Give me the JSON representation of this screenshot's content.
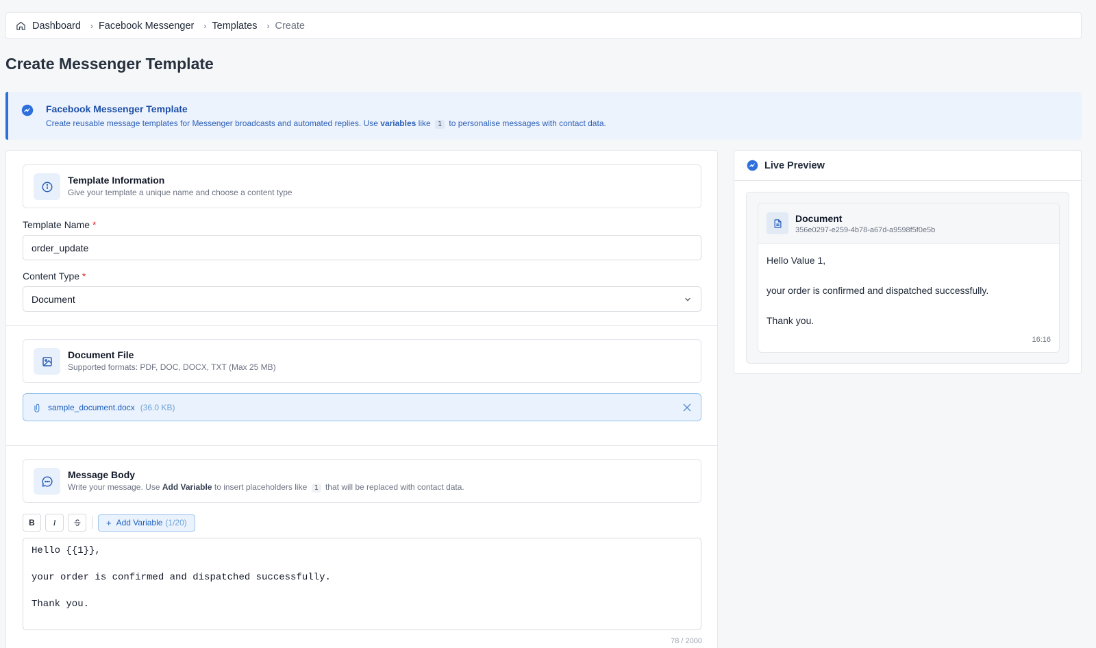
{
  "breadcrumb": {
    "home_icon": "home-icon",
    "items": [
      "Dashboard",
      "Facebook Messenger",
      "Templates",
      "Create"
    ]
  },
  "page": {
    "title": "Create Messenger Template"
  },
  "banner": {
    "icon": "messenger-icon",
    "title": "Facebook Messenger Template",
    "text_before": "Create reusable message templates for Messenger broadcasts and automated replies. Use ",
    "bold": "variables",
    "text_mid": " like ",
    "pill": "1",
    "text_after": " to personalise messages with contact data."
  },
  "template_info": {
    "icon": "info-icon",
    "title": "Template Information",
    "subtitle": "Give your template a unique name and choose a content type",
    "name_label": "Template Name",
    "name_value": "order_update",
    "type_label": "Content Type",
    "type_value": "Document",
    "required_mark": "*"
  },
  "document_file": {
    "icon": "image-icon",
    "title": "Document File",
    "subtitle": "Supported formats: PDF, DOC, DOCX, TXT (Max 25 MB)",
    "file_name": "sample_document.docx",
    "file_size": "(36.0 KB)"
  },
  "message_body": {
    "icon": "chat-icon",
    "title": "Message Body",
    "sub_before": "Write your message. Use ",
    "sub_bold": "Add Variable",
    "sub_mid": " to insert placeholders like ",
    "sub_pill": "1",
    "sub_after": " that will be replaced with contact data.",
    "toolbar": {
      "bold": "B",
      "italic": "I",
      "add_variable": "Add Variable",
      "variable_count": "(1/20)"
    },
    "content": "Hello {{1}},\n\nyour order is confirmed and dispatched successfully.\n\nThank you.",
    "char_count": "78 / 2000"
  },
  "preview": {
    "title": "Live Preview",
    "doc_title": "Document",
    "doc_id": "356e0297-e259-4b78-a67d-a9598f5f0e5b",
    "message": "Hello Value 1,\n\nyour order is confirmed and dispatched successfully.\n\nThank you.",
    "time": "16:16"
  },
  "colors": {
    "accent": "#2f6fdc",
    "banner_bg": "#edf3fc",
    "required": "#dc2626"
  }
}
